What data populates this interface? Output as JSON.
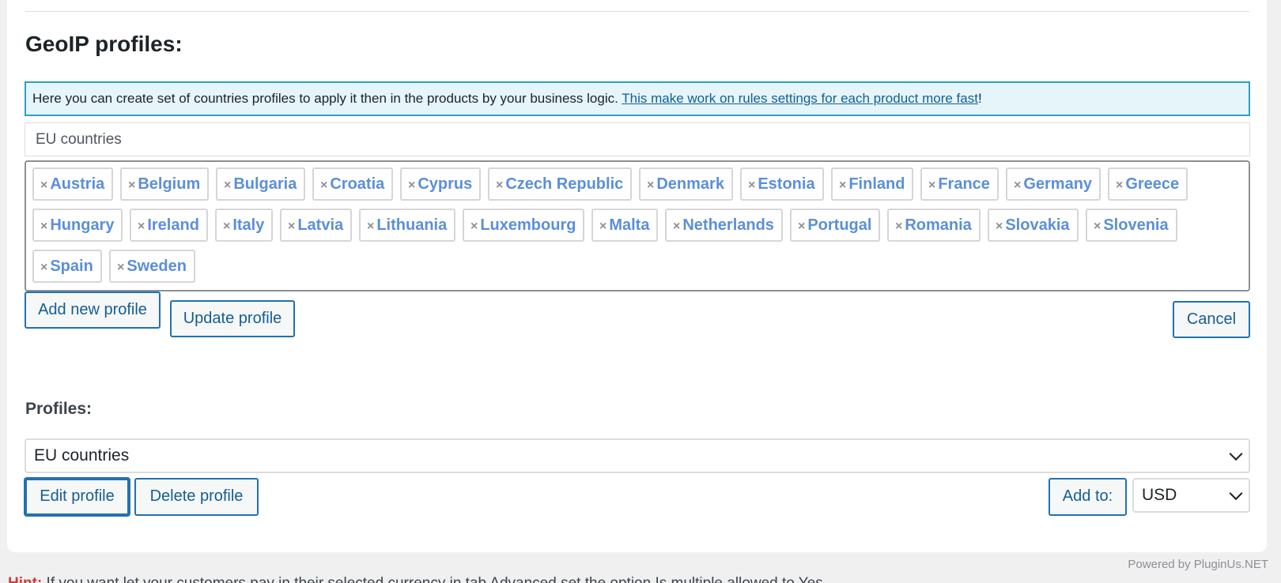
{
  "section": {
    "title": "GeoIP profiles:",
    "notice_text": "Here you can create set of countries profiles to apply it then in the products by your business logic. ",
    "notice_link": "This make work on rules settings for each product more fast",
    "notice_suffix": "!"
  },
  "editor": {
    "profile_name_value": "EU countries",
    "remove_glyph": "×",
    "countries": [
      "Austria",
      "Belgium",
      "Bulgaria",
      "Croatia",
      "Cyprus",
      "Czech Republic",
      "Denmark",
      "Estonia",
      "Finland",
      "France",
      "Germany",
      "Greece",
      "Hungary",
      "Ireland",
      "Italy",
      "Latvia",
      "Lithuania",
      "Luxembourg",
      "Malta",
      "Netherlands",
      "Portugal",
      "Romania",
      "Slovakia",
      "Slovenia",
      "Spain",
      "Sweden"
    ],
    "add_new_label": "Add new profile",
    "update_label": "Update profile",
    "cancel_label": "Cancel"
  },
  "profiles": {
    "label": "Profiles:",
    "selected": "EU countries",
    "edit_label": "Edit profile",
    "delete_label": "Delete profile",
    "add_to_label": "Add to:",
    "currency": "USD"
  },
  "footer": {
    "powered": "Powered by PluginUs.NET",
    "hint_label": "Hint:",
    "hint_text": " If you want let your customers pay in their selected currency in tab Advanced set the option Is multiple allowed to Yes."
  },
  "colors": {
    "accent": "#2271b1",
    "notice_bg": "#e5f5fa",
    "tag_text": "#5b8fd9",
    "hint_label": "#d63638"
  },
  "icons": {
    "tag_remove": "close-icon",
    "select_arrow": "chevron-down-icon"
  }
}
